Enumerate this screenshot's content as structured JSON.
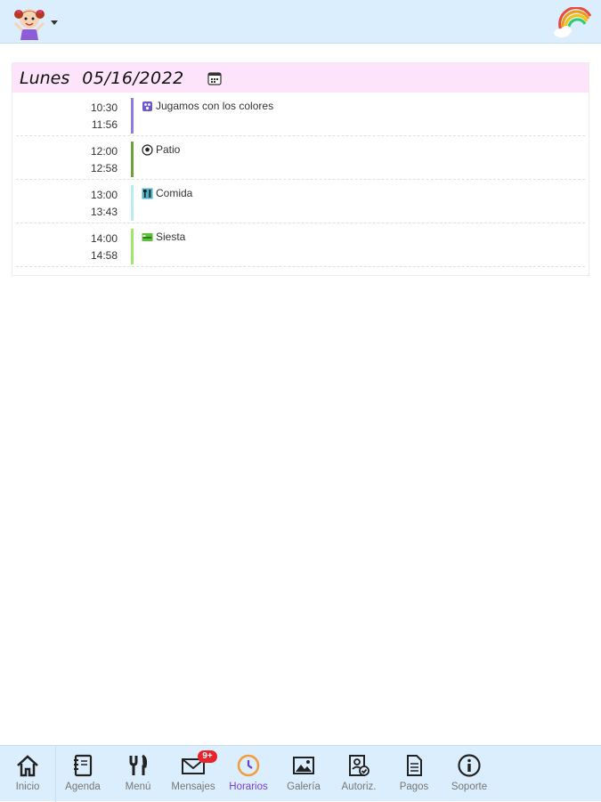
{
  "header": {
    "avatar_icon": "girl-avatar-icon",
    "logo_icon": "rainbow-cloud-icon"
  },
  "schedule": {
    "day_name": "Lunes",
    "date": "05/16/2022",
    "calendar_icon": "calendar-icon",
    "entries": [
      {
        "start": "10:30",
        "end": "11:56",
        "activity": "Jugamos con los colores",
        "icon": "palette-icon",
        "color": "#8a7fe0"
      },
      {
        "start": "12:00",
        "end": "12:58",
        "activity": "Patio",
        "icon": "ball-icon",
        "color": "#6ea23b"
      },
      {
        "start": "13:00",
        "end": "13:43",
        "activity": "Comida",
        "icon": "cutlery-icon",
        "color": "#b9ecef"
      },
      {
        "start": "14:00",
        "end": "14:58",
        "activity": "Siesta",
        "icon": "bed-icon",
        "color": "#9ee76a"
      }
    ]
  },
  "nav": {
    "items": [
      {
        "label": "Inicio",
        "icon": "home-icon"
      },
      {
        "label": "Agenda",
        "icon": "notebook-icon"
      },
      {
        "label": "Menú",
        "icon": "cutlery-icon"
      },
      {
        "label": "Mensajes",
        "icon": "envelope-icon",
        "badge": "9+"
      },
      {
        "label": "Horarios",
        "icon": "clock-icon",
        "active": true
      },
      {
        "label": "Galería",
        "icon": "image-icon"
      },
      {
        "label": "Autoriz.",
        "icon": "authorization-icon"
      },
      {
        "label": "Pagos",
        "icon": "document-icon"
      },
      {
        "label": "Soporte",
        "icon": "info-icon"
      }
    ]
  },
  "colors": {
    "header_bg": "#dbeefd",
    "day_bar_bg": "#fde4fb",
    "active_nav": "#7a3fd0",
    "badge": "#e5252b"
  }
}
